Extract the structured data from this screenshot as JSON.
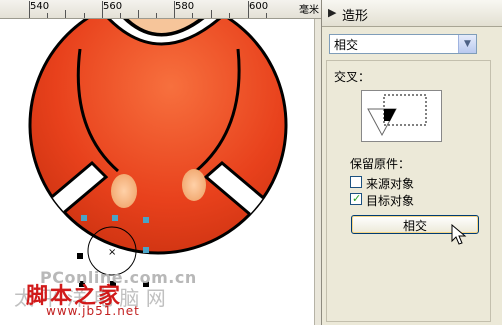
{
  "ruler": {
    "labels": [
      "540",
      "560",
      "580",
      "600"
    ],
    "unit": "毫米"
  },
  "panel": {
    "title": "造形",
    "mode_value": "相交",
    "intersect_label": "交叉：",
    "keep_label": "保留原件：",
    "source_object_label": "来源对象",
    "source_object_checked": false,
    "target_object_label": "目标对象",
    "target_object_checked": true,
    "apply_button_label": "相交"
  },
  "watermark": {
    "site": "PConline.com.cn",
    "gray_text": "太 平 洋 电 脑 网",
    "brand": "脚本之家",
    "url": "www.jb51.net"
  },
  "colors": {
    "body_fill": "#e8411c",
    "panel_bg": "#ece9d8",
    "selection_handle": "#4aa3c6"
  }
}
